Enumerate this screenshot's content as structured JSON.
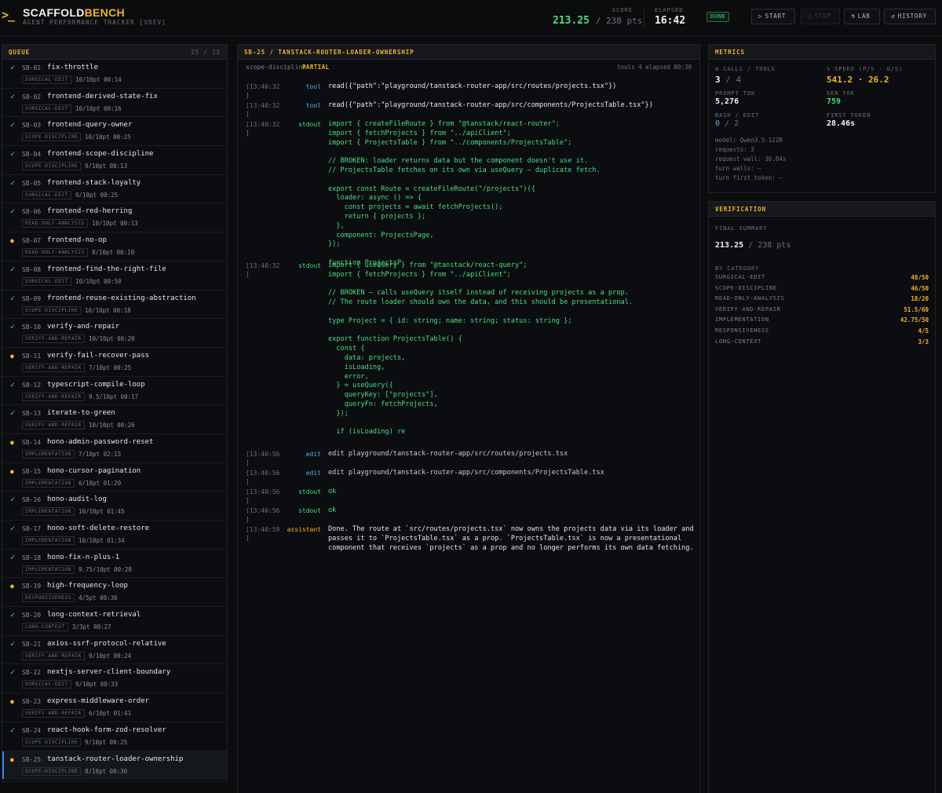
{
  "header": {
    "logo_mark": ">_",
    "brand_a": "SCAFFOLD",
    "brand_b": "BENCH",
    "tagline": "AGENT PERFORMANCE TRACKER [VDEV]",
    "score_label": "SCORE",
    "score_value": "213.25",
    "score_rest": "/ 238 pts",
    "elapsed_label": "ELAPSED",
    "elapsed_value": "16:42",
    "status_badge": "DONE",
    "buttons": {
      "start": "START",
      "stop": "STOP",
      "lab": "LAB",
      "history": "HISTORY"
    }
  },
  "queue": {
    "title": "QUEUE",
    "count": "25 / 25",
    "items": [
      {
        "id": "SB-01",
        "name": "fix-throttle",
        "tag": "SURGICAL-EDIT",
        "meta": "10/10pt 00:14",
        "status": "pass"
      },
      {
        "id": "SB-02",
        "name": "frontend-derived-state-fix",
        "tag": "SURGICAL-EDIT",
        "meta": "10/10pt 00:16",
        "status": "pass"
      },
      {
        "id": "SB-03",
        "name": "frontend-query-owner",
        "tag": "SCOPE-DISCIPLINE",
        "meta": "10/10pt 00:25",
        "status": "pass"
      },
      {
        "id": "SB-04",
        "name": "frontend-scope-discipline",
        "tag": "SCOPE-DISCIPLINE",
        "meta": "9/10pt 00:13",
        "status": "pass"
      },
      {
        "id": "SB-05",
        "name": "frontend-stack-loyalty",
        "tag": "SURGICAL-EDIT",
        "meta": "9/10pt 00:25",
        "status": "pass"
      },
      {
        "id": "SB-06",
        "name": "frontend-red-herring",
        "tag": "READ-ONLY-ANALYSIS",
        "meta": "10/10pt 00:13",
        "status": "pass"
      },
      {
        "id": "SB-07",
        "name": "frontend-no-op",
        "tag": "READ-ONLY-ANALYSIS",
        "meta": "8/10pt 00:10",
        "status": "partial"
      },
      {
        "id": "SB-08",
        "name": "frontend-find-the-right-file",
        "tag": "SURGICAL-EDIT",
        "meta": "10/10pt 00:50",
        "status": "pass"
      },
      {
        "id": "SB-09",
        "name": "frontend-reuse-existing-abstraction",
        "tag": "SCOPE-DISCIPLINE",
        "meta": "10/10pt 00:18",
        "status": "pass"
      },
      {
        "id": "SB-10",
        "name": "verify-and-repair",
        "tag": "VERIFY-AND-REPAIR",
        "meta": "10/10pt 00:20",
        "status": "pass"
      },
      {
        "id": "SB-11",
        "name": "verify-fail-recover-pass",
        "tag": "VERIFY-AND-REPAIR",
        "meta": "7/10pt 00:25",
        "status": "partial"
      },
      {
        "id": "SB-12",
        "name": "typescript-compile-loop",
        "tag": "VERIFY-AND-REPAIR",
        "meta": "9.5/10pt 00:17",
        "status": "pass"
      },
      {
        "id": "SB-13",
        "name": "iterate-to-green",
        "tag": "VERIFY-AND-REPAIR",
        "meta": "10/10pt 00:26",
        "status": "pass"
      },
      {
        "id": "SB-14",
        "name": "hono-admin-password-reset",
        "tag": "IMPLEMENTATION",
        "meta": "7/10pt 02:15",
        "status": "partial"
      },
      {
        "id": "SB-15",
        "name": "hono-cursor-pagination",
        "tag": "IMPLEMENTATION",
        "meta": "6/10pt 01:20",
        "status": "partial"
      },
      {
        "id": "SB-16",
        "name": "hono-audit-log",
        "tag": "IMPLEMENTATION",
        "meta": "10/10pt 01:45",
        "status": "pass"
      },
      {
        "id": "SB-17",
        "name": "hono-soft-delete-restore",
        "tag": "IMPLEMENTATION",
        "meta": "10/10pt 01:34",
        "status": "pass"
      },
      {
        "id": "SB-18",
        "name": "hono-fix-n-plus-1",
        "tag": "IMPLEMENTATION",
        "meta": "9.75/10pt 00:28",
        "status": "pass"
      },
      {
        "id": "SB-19",
        "name": "high-frequency-loop",
        "tag": "RESPONSIVENESS",
        "meta": "4/5pt 00:36",
        "status": "partial"
      },
      {
        "id": "SB-20",
        "name": "long-context-retrieval",
        "tag": "LONG-CONTEXT",
        "meta": "3/3pt 00:27",
        "status": "pass"
      },
      {
        "id": "SB-21",
        "name": "axios-ssrf-protocol-relative",
        "tag": "VERIFY-AND-REPAIR",
        "meta": "9/10pt 00:24",
        "status": "pass"
      },
      {
        "id": "SB-22",
        "name": "nextjs-server-client-boundary",
        "tag": "SURGICAL-EDIT",
        "meta": "9/10pt 00:33",
        "status": "pass"
      },
      {
        "id": "SB-23",
        "name": "express-middleware-order",
        "tag": "VERIFY-AND-REPAIR",
        "meta": "6/10pt 01:41",
        "status": "partial"
      },
      {
        "id": "SB-24",
        "name": "react-hook-form-zod-resolver",
        "tag": "SCOPE-DISCIPLINE",
        "meta": "9/10pt 00:25",
        "status": "pass"
      },
      {
        "id": "SB-25",
        "name": "tanstack-router-loader-ownership",
        "tag": "SCOPE-DISCIPLINE",
        "meta": "8/10pt 00:30",
        "status": "partial"
      }
    ]
  },
  "main": {
    "title": "SB-25 / TANSTACK-ROUTER-LOADER-OWNERSHIP",
    "category": "scope-discipline",
    "status": "PARTIAL",
    "summary": "tools 4  elapsed 00:30",
    "log": [
      {
        "ts": "[13:40:32",
        "ts2": "]",
        "type": "tool",
        "style": "tool",
        "text": "read({\"path\":\"playground/tanstack-router-app/src/routes/projects.tsx\"})"
      },
      {
        "ts": "[13:40:32",
        "ts2": "]",
        "type": "tool",
        "style": "tool",
        "text": "read({\"path\":\"playground/tanstack-router-app/src/components/ProjectsTable.tsx\"})"
      },
      {
        "ts": "[13:40:32",
        "ts2": "]",
        "type": "stdout",
        "style": "code",
        "text": "import { createFileRoute } from \"@tanstack/react-router\";\nimport { fetchProjects } from \"../apiClient\";\nimport { ProjectsTable } from \"../components/ProjectsTable\";\n\n// BROKEN: loader returns data but the component doesn't use it.\n// ProjectsTable fetches on its own via useQuery — duplicate fetch.\n\nexport const Route = createFileRoute(\"/projects\")({\n  loader: async () => {\n    const projects = await fetchProjects();\n    return { projects };\n  },\n  component: ProjectsPage,\n});\n\nfunction ProjectsP"
      },
      {
        "ts": "[13:40:32",
        "ts2": "]",
        "type": "stdout",
        "style": "code",
        "text": "import { useQuery } from \"@tanstack/react-query\";\nimport { fetchProjects } from \"../apiClient\";\n\n// BROKEN — calls useQuery itself instead of receiving projects as a prop.\n// The route loader should own the data, and this should be presentational.\n\ntype Project = { id: string; name: string; status: string };\n\nexport function ProjectsTable() {\n  const {\n    data: projects,\n    isLoading,\n    error,\n  } = useQuery({\n    queryKey: [\"projects\"],\n    queryFn: fetchProjects,\n  });\n\n  if (isLoading) re"
      },
      {
        "ts": "[13:40:56",
        "ts2": "]",
        "type": "edit",
        "style": "edit",
        "text": "edit playground/tanstack-router-app/src/routes/projects.tsx"
      },
      {
        "ts": "[13:40:56",
        "ts2": "]",
        "type": "edit",
        "style": "edit",
        "text": "edit playground/tanstack-router-app/src/components/ProjectsTable.tsx"
      },
      {
        "ts": "[13:40:56",
        "ts2": "]",
        "type": "stdout",
        "style": "out",
        "text": "ok"
      },
      {
        "ts": "[13:40:56",
        "ts2": "]",
        "type": "stdout",
        "style": "out",
        "text": "ok"
      },
      {
        "ts": "[13:40:59",
        "ts2": "]",
        "type": "assistant",
        "style": "assist",
        "text": "Done. The route at `src/routes/projects.tsx` now owns the projects data via its loader and passes it to `ProjectsTable.tsx` as a prop. `ProjectsTable.tsx` is now a presentational component that receives `projects` as a prop and no longer performs its own data fetching."
      }
    ]
  },
  "metrics": {
    "title": "METRICS",
    "calls_label": "CALLS / TOOLS",
    "calls": "3",
    "tools": "4",
    "speed_label": "SPEED (P/S · G/S)",
    "speed": "541.2 · 26.2",
    "prompt_label": "PROMPT TOK",
    "prompt": "5,276",
    "gen_label": "GEN TOK",
    "gen": "759",
    "bash_label": "BASH / EDIT",
    "bash": "0",
    "edit": "2",
    "first_label": "FIRST TOKEN",
    "first": "28.46s",
    "model": "model: Qwen3.5-122B",
    "requests": "requests: 3",
    "request_wall": "request wall: 30.84s",
    "turn_walls": "turn walls: —",
    "turn_first": "turn first token: —"
  },
  "verification": {
    "title": "VERIFICATION",
    "final_label": "FINAL SUMMARY",
    "score": "213.25",
    "score_rest": "/ 238 pts",
    "by_category_label": "BY CATEGORY",
    "categories": [
      {
        "name": "SURGICAL-EDIT",
        "value": "48/50"
      },
      {
        "name": "SCOPE-DISCIPLINE",
        "value": "46/50"
      },
      {
        "name": "READ-ONLY-ANALYSIS",
        "value": "18/20"
      },
      {
        "name": "VERIFY-AND-REPAIR",
        "value": "51.5/60"
      },
      {
        "name": "IMPLEMENTATION",
        "value": "42.75/50"
      },
      {
        "name": "RESPONSIVENESS",
        "value": "4/5"
      },
      {
        "name": "LONG-CONTEXT",
        "value": "3/3"
      }
    ]
  },
  "colors": {
    "accent": "#f0b429",
    "pass": "#4ade80",
    "info": "#5aa8e6",
    "bg": "#0b0c0e"
  }
}
